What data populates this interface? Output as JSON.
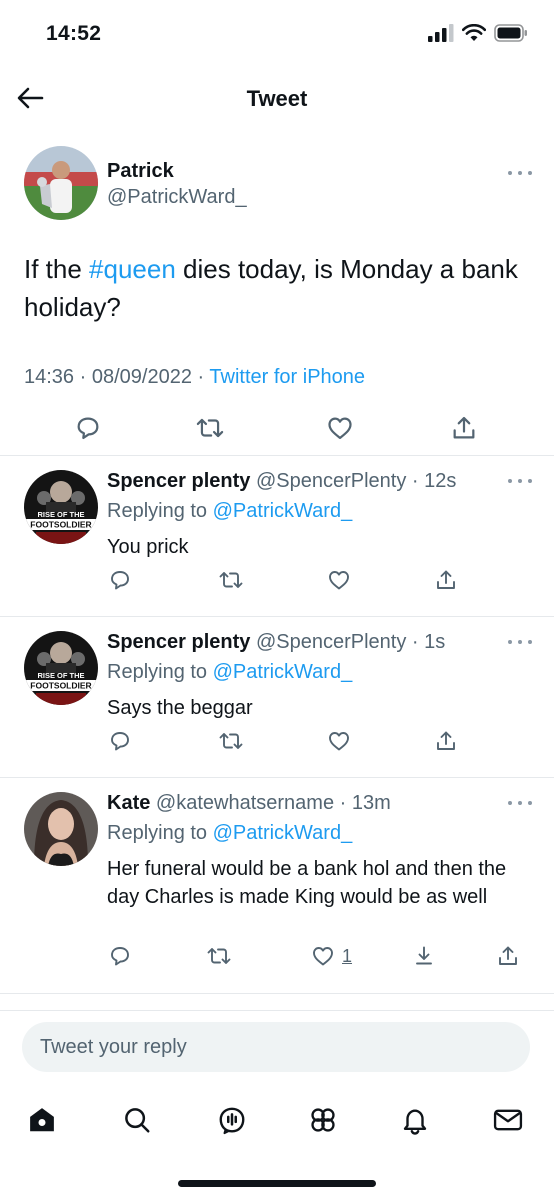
{
  "status_bar": {
    "time": "14:52"
  },
  "header": {
    "title": "Tweet"
  },
  "tweet": {
    "name": "Patrick",
    "handle": "@PatrickWard_",
    "text_before": "If the ",
    "hashtag": "#queen",
    "text_after": " dies today, is Monday a bank holiday?",
    "time": "14:36",
    "date": "08/09/2022",
    "separator": "·",
    "source": "Twitter for iPhone"
  },
  "replies": [
    {
      "name": "Spencer plenty",
      "handle": "@SpencerPlenty",
      "time": "· 12s",
      "replying_prefix": "Replying to ",
      "replying_to": "@PatrickWard_",
      "text": "You prick",
      "avatar_text_1": "RISE OF THE",
      "avatar_text_2": "FOOTSOLDIER",
      "like_count": ""
    },
    {
      "name": "Spencer plenty",
      "handle": "@SpencerPlenty",
      "time": "· 1s",
      "replying_prefix": "Replying to ",
      "replying_to": "@PatrickWard_",
      "text": "Says the beggar",
      "avatar_text_1": "RISE OF THE",
      "avatar_text_2": "FOOTSOLDIER",
      "like_count": ""
    },
    {
      "name": "Kate",
      "handle": "@katewhatsername",
      "time": "· 13m",
      "replying_prefix": "Replying to ",
      "replying_to": "@PatrickWard_",
      "text": "Her funeral would be a bank hol and then the day Charles is made King would be as well",
      "like_count": "1"
    }
  ],
  "compose": {
    "placeholder": "Tweet your reply"
  },
  "tabbar": {
    "items": [
      "home-icon",
      "search-icon",
      "spaces-icon",
      "communities-icon",
      "notifications-icon",
      "messages-icon"
    ]
  },
  "colors": {
    "accent": "#1d9bf0",
    "muted": "#536471",
    "text": "#0f1419"
  }
}
